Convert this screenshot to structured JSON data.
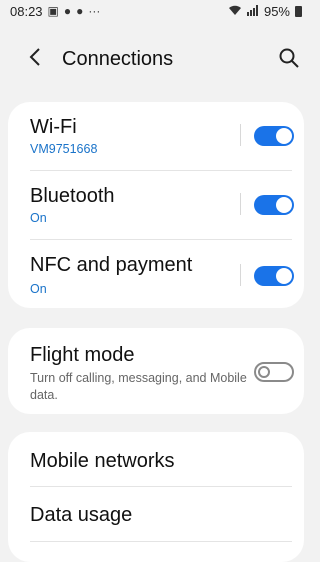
{
  "status_bar": {
    "time": "08:23",
    "more": "···",
    "battery": "95%"
  },
  "header": {
    "title": "Connections"
  },
  "connections": [
    {
      "title": "Wi-Fi",
      "subtitle": "VM9751668",
      "toggle": "on"
    },
    {
      "title": "Bluetooth",
      "subtitle": "On",
      "toggle": "on"
    },
    {
      "title": "NFC and payment",
      "subtitle": "On",
      "toggle": "on"
    }
  ],
  "flight_mode": {
    "title": "Flight mode",
    "description": "Turn off calling, messaging, and Mobile data.",
    "toggle": "off"
  },
  "more_items": [
    {
      "title": "Mobile networks"
    },
    {
      "title": "Data usage"
    }
  ],
  "colors": {
    "accent": "#1a73e8",
    "card_background": "#ffffff",
    "page_background": "#f2f2f2"
  }
}
